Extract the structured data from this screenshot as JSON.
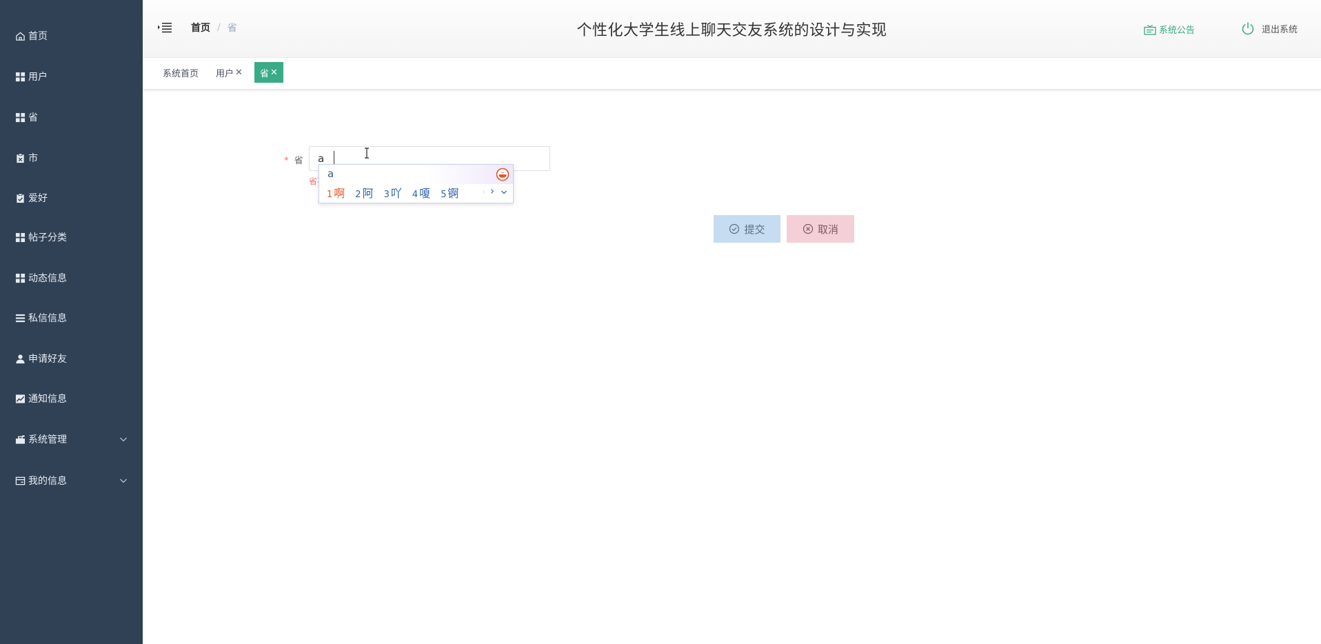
{
  "sidebar": {
    "items": [
      {
        "label": "首页",
        "icon": "home-icon"
      },
      {
        "label": "用户",
        "icon": "grid-icon"
      },
      {
        "label": "省",
        "icon": "grid-icon"
      },
      {
        "label": "市",
        "icon": "clipboard-icon"
      },
      {
        "label": "爱好",
        "icon": "check-clipboard-icon"
      },
      {
        "label": "帖子分类",
        "icon": "grid-icon"
      },
      {
        "label": "动态信息",
        "icon": "grid-icon"
      },
      {
        "label": "私信信息",
        "icon": "list-icon"
      },
      {
        "label": "申请好友",
        "icon": "user-icon"
      },
      {
        "label": "通知信息",
        "icon": "chart-icon"
      },
      {
        "label": "系统管理",
        "icon": "toolbox-icon"
      },
      {
        "label": "我的信息",
        "icon": "card-icon"
      }
    ]
  },
  "header": {
    "breadcrumb": {
      "home": "首页",
      "separator": "/",
      "current": "省"
    },
    "title": "个性化大学生线上聊天交友系统的设计与实现",
    "notice_label": "系统公告",
    "logout_label": "退出系统"
  },
  "tags": [
    {
      "label": "系统首页",
      "closable": false,
      "active": false
    },
    {
      "label": "用户",
      "closable": true,
      "active": false
    },
    {
      "label": "省",
      "closable": true,
      "active": true
    }
  ],
  "form": {
    "required_mark": "*",
    "province_label": "省",
    "province_value": "a",
    "error_text": "省不能为空"
  },
  "ime": {
    "composition": "a",
    "candidates": [
      {
        "num": "1",
        "text": "啊"
      },
      {
        "num": "2",
        "text": "阿"
      },
      {
        "num": "3",
        "text": "吖"
      },
      {
        "num": "4",
        "text": "嗄"
      },
      {
        "num": "5",
        "text": "锕"
      }
    ],
    "prev": "‹",
    "next": "›"
  },
  "buttons": {
    "submit": "提交",
    "cancel": "取消"
  },
  "colors": {
    "sidebar_bg": "#304156",
    "accent": "#3aab87",
    "submit_bg": "#c6dcf1",
    "cancel_bg": "#f5cfd7",
    "error": "#f56c6c"
  }
}
